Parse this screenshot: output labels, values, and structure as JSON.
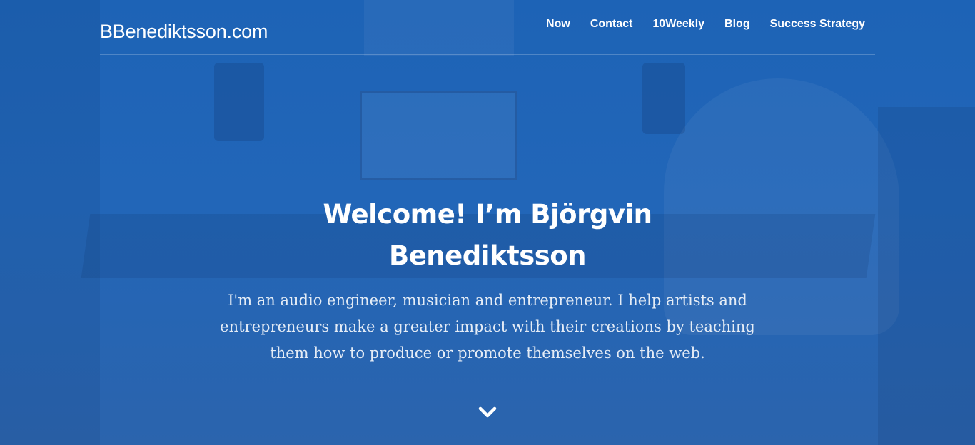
{
  "site": {
    "brand": "BBenediktsson.com"
  },
  "nav": {
    "items": [
      {
        "label": "Now"
      },
      {
        "label": "Contact"
      },
      {
        "label": "10Weekly"
      },
      {
        "label": "Blog"
      },
      {
        "label": "Success Strategy"
      }
    ]
  },
  "hero": {
    "headline_line1": "Welcome! I’m Björgvin",
    "headline_line2": "Benediktsson",
    "subtitle": "I'm an audio engineer, musician and entrepreneur. I help artists and entrepreneurs make a greater impact with their creations by teaching them how to produce or promote themselves on the web.",
    "scroll_icon": "chevron-down-icon"
  },
  "colors": {
    "overlay": "#1d63b6",
    "text": "#ffffff"
  }
}
